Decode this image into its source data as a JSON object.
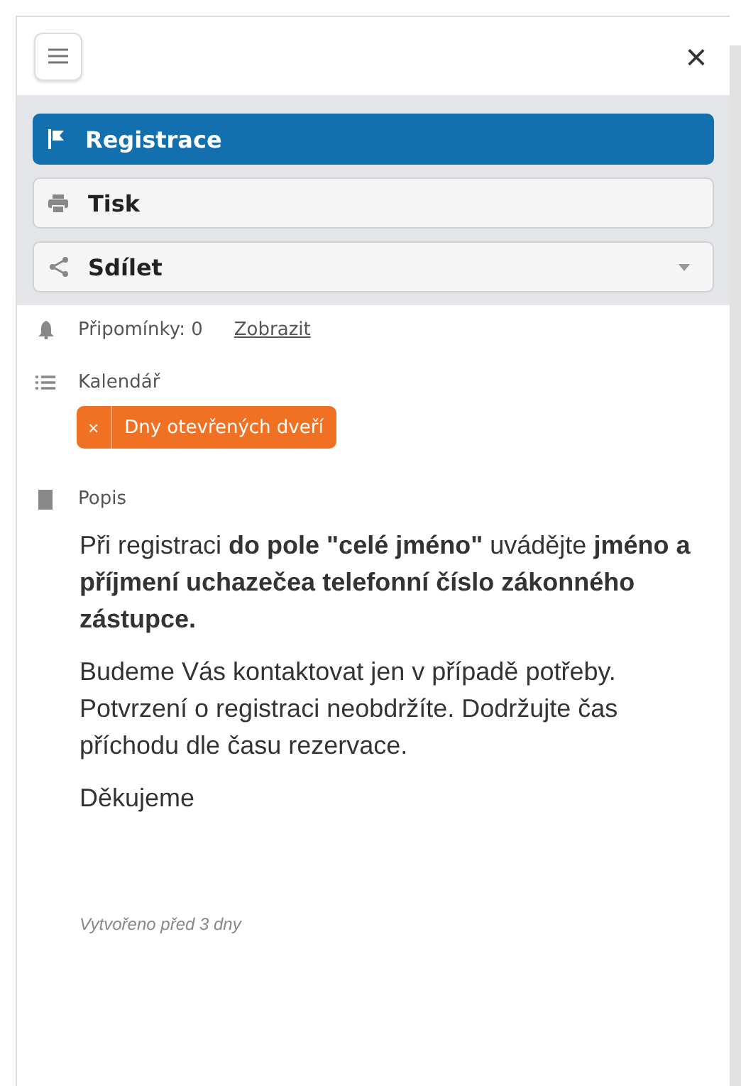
{
  "header": {
    "close": "×"
  },
  "actions": [
    {
      "kind": "primary",
      "label": "Registrace"
    },
    {
      "kind": "plain",
      "label": "Tisk"
    },
    {
      "kind": "dropdown",
      "label": "Sdílet"
    }
  ],
  "reminders": {
    "label": "Připomínky: 0",
    "link": "Zobrazit"
  },
  "calendar": {
    "label": "Kalendář",
    "tags": [
      {
        "remove": "×",
        "label": "Dny otevřených dveří",
        "color": "#f07124"
      }
    ]
  },
  "description": {
    "label": "Popis",
    "paragraphs": [
      "Při registraci **do pole \"celé jméno\"** uvádějte **jméno a příjmení uchazečea telefonní číslo zákonného zástupce.**",
      "Budeme Vás kontaktovat jen v případě potřeby. Potvrzení o registraci neobdržíte. Dodržujte čas příchodu dle času rezervace.",
      "Děkujeme"
    ]
  },
  "created": "Vytvořeno před 3 dny"
}
